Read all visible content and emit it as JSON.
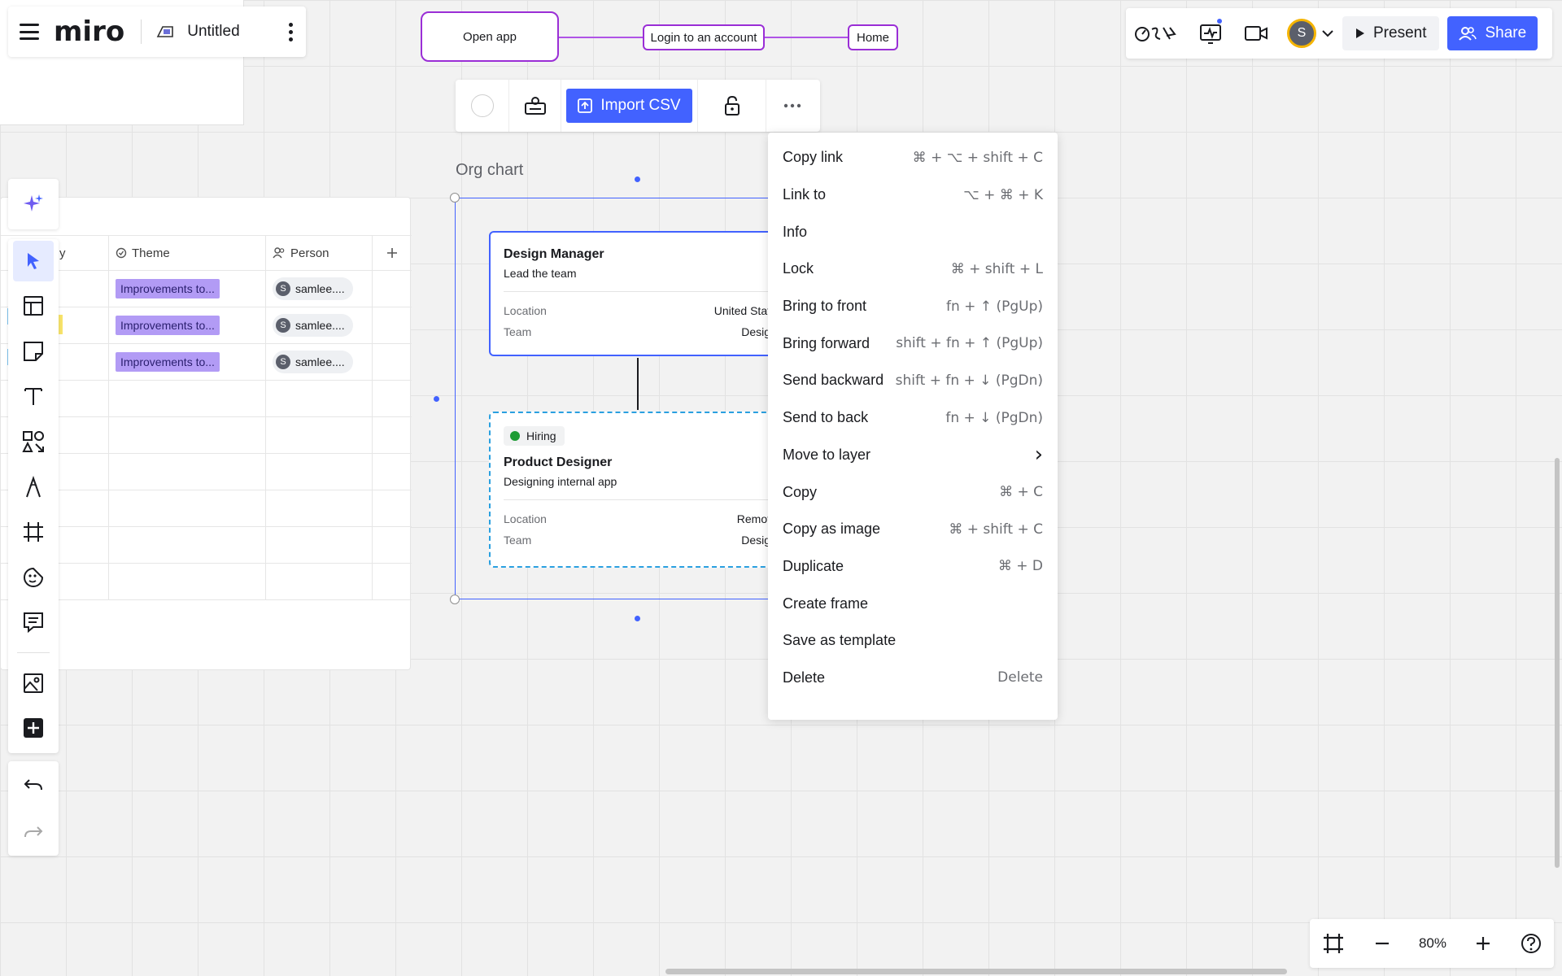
{
  "board": {
    "logo": "miro",
    "title": "Untitled"
  },
  "flow": {
    "nodes": [
      "Open app",
      "Login to an account",
      "Home"
    ]
  },
  "topbar_right": {
    "avatar_initial": "S",
    "present_label": "Present",
    "share_label": "Share",
    "colors": {
      "accent": "#4262ff",
      "avatar_ring": "#f5b400"
    }
  },
  "toolbar": {
    "import_label": "Import CSV"
  },
  "table": {
    "columns": [
      "y",
      "Theme",
      "Person"
    ],
    "rows": [
      {
        "theme": "Improvements to...",
        "person": "samlee...."
      },
      {
        "theme": "Improvements to...",
        "person": "samlee...."
      },
      {
        "theme": "Improvements to...",
        "person": "samlee...."
      }
    ],
    "avatar_initial": "S"
  },
  "org": {
    "title": "Org chart",
    "card1": {
      "name": "Design Manager",
      "role": "Lead the team",
      "location_label": "Location",
      "location_value": "United Stat",
      "team_label": "Team",
      "team_value": "Desig"
    },
    "card2": {
      "status": "Hiring",
      "name": "Product Designer",
      "role": "Designing internal app",
      "location_label": "Location",
      "location_value": "Remot",
      "team_label": "Team",
      "team_value": "Desig"
    }
  },
  "menu": {
    "items": [
      {
        "label": "Copy link",
        "shortcut": "⌘ + ⌥ + shift + C"
      },
      {
        "label": "Link to",
        "shortcut": "⌥ + ⌘ + K"
      },
      {
        "label": "Info",
        "shortcut": ""
      },
      {
        "label": "Lock",
        "shortcut": "⌘ + shift + L"
      },
      {
        "label": "Bring to front",
        "shortcut": "fn + ↑ (PgUp)"
      },
      {
        "label": "Bring forward",
        "shortcut": "shift + fn + ↑ (PgUp)"
      },
      {
        "label": "Send backward",
        "shortcut": "shift + fn + ↓ (PgDn)"
      },
      {
        "label": "Send to back",
        "shortcut": "fn + ↓ (PgDn)"
      },
      {
        "label": "Move to layer",
        "shortcut": "›"
      },
      {
        "label": "Copy",
        "shortcut": "⌘ + C"
      },
      {
        "label": "Copy as image",
        "shortcut": "⌘ + shift + C"
      },
      {
        "label": "Duplicate",
        "shortcut": "⌘ + D"
      },
      {
        "label": "Create frame",
        "shortcut": ""
      },
      {
        "label": "Save as template",
        "shortcut": ""
      },
      {
        "label": "Delete",
        "shortcut": "Delete"
      }
    ]
  },
  "zoom": {
    "value": "80%"
  }
}
